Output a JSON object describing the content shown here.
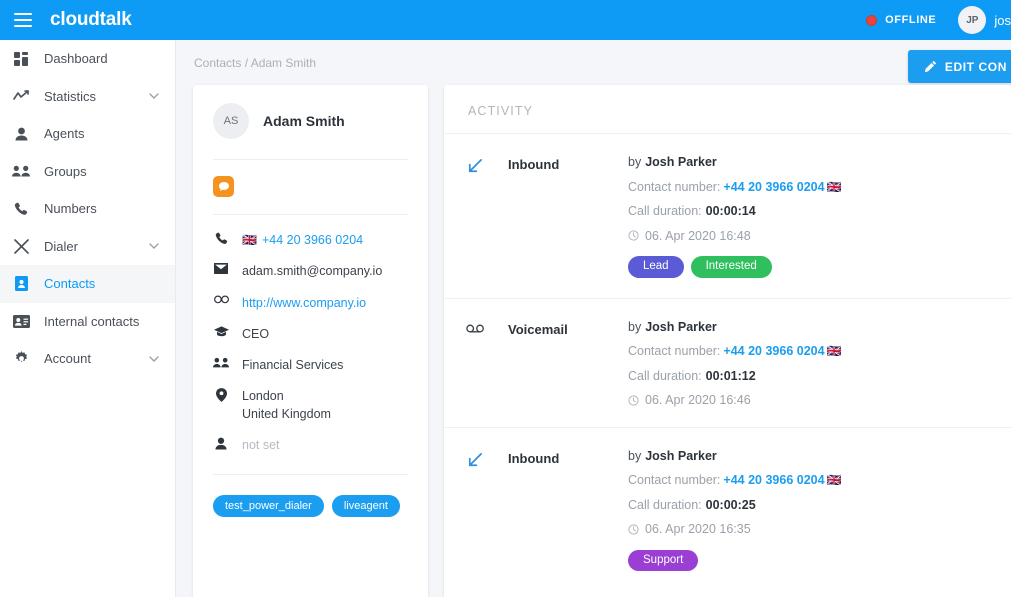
{
  "topbar": {
    "brand": "cloudtalk",
    "menu_icon": "hamburger-icon",
    "status_label": "OFFLINE",
    "status_color": "#e8453c",
    "avatar_initials": "JP",
    "user_name": "jos",
    "background": "#0d9bf5"
  },
  "sidebar": {
    "items": [
      {
        "label": "Dashboard",
        "icon": "dashboard-icon",
        "active": false,
        "chevron": false
      },
      {
        "label": "Statistics",
        "icon": "statistics-icon",
        "active": false,
        "chevron": true
      },
      {
        "label": "Agents",
        "icon": "agent-icon",
        "active": false,
        "chevron": false
      },
      {
        "label": "Groups",
        "icon": "groups-icon",
        "active": false,
        "chevron": false
      },
      {
        "label": "Numbers",
        "icon": "phone-icon",
        "active": false,
        "chevron": false
      },
      {
        "label": "Dialer",
        "icon": "dialer-icon",
        "active": false,
        "chevron": true
      },
      {
        "label": "Contacts",
        "icon": "contacts-icon",
        "active": true,
        "chevron": false
      },
      {
        "label": "Internal contacts",
        "icon": "internal-contacts-icon",
        "active": false,
        "chevron": false
      },
      {
        "label": "Account",
        "icon": "gear-icon",
        "active": false,
        "chevron": true
      }
    ]
  },
  "breadcrumb": "Contacts / Adam Smith",
  "edit_button": {
    "label": "EDIT CON",
    "icon": "pencil-icon",
    "color": "#1b9df0"
  },
  "profile": {
    "avatar_initials": "AS",
    "name": "Adam Smith",
    "integration_icon": "liveagent-chat-icon",
    "integration_color": "#f59320",
    "details": [
      {
        "icon": "phone-icon",
        "flag": "🇬🇧",
        "value": "+44 20 3966 0204",
        "style": "link"
      },
      {
        "icon": "email-icon",
        "flag": "",
        "value": "adam.smith@company.io",
        "style": "normal"
      },
      {
        "icon": "link-icon",
        "flag": "",
        "value": "http://www.company.io",
        "style": "link"
      },
      {
        "icon": "education-icon",
        "flag": "",
        "value": "CEO",
        "style": "normal"
      },
      {
        "icon": "people-icon",
        "flag": "",
        "value": "Financial Services",
        "style": "normal"
      },
      {
        "icon": "location-icon",
        "flag": "",
        "value": "London\nUnited Kingdom",
        "style": "normal"
      },
      {
        "icon": "person-icon",
        "flag": "",
        "value": "not set",
        "style": "muted"
      }
    ],
    "tags": [
      {
        "label": "test_power_dialer",
        "color": "#1b9df0"
      },
      {
        "label": "liveagent",
        "color": "#1b9df0"
      }
    ]
  },
  "activity": {
    "title": "ACTIVITY",
    "entries": [
      {
        "icon": "inbound-call-icon",
        "type": "Inbound",
        "by_prefix": "by",
        "by_name": "Josh Parker",
        "contact_number_label": "Contact number:",
        "contact_number": "+44 20 3966 0204",
        "flag": "🇬🇧",
        "duration_label": "Call duration:",
        "duration": "00:00:14",
        "timestamp": "06. Apr 2020 16:48",
        "tags": [
          {
            "label": "Lead",
            "color": "#5b5bd6"
          },
          {
            "label": "Interested",
            "color": "#2fbf5f"
          }
        ]
      },
      {
        "icon": "voicemail-icon",
        "type": "Voicemail",
        "by_prefix": "by",
        "by_name": "Josh Parker",
        "contact_number_label": "Contact number:",
        "contact_number": "+44 20 3966 0204",
        "flag": "🇬🇧",
        "duration_label": "Call duration:",
        "duration": "00:01:12",
        "timestamp": "06. Apr 2020 16:46",
        "tags": []
      },
      {
        "icon": "inbound-call-icon",
        "type": "Inbound",
        "by_prefix": "by",
        "by_name": "Josh Parker",
        "contact_number_label": "Contact number:",
        "contact_number": "+44 20 3966 0204",
        "flag": "🇬🇧",
        "duration_label": "Call duration:",
        "duration": "00:00:25",
        "timestamp": "06. Apr 2020 16:35",
        "tags": [
          {
            "label": "Support",
            "color": "#9b3fd4"
          }
        ]
      }
    ]
  }
}
